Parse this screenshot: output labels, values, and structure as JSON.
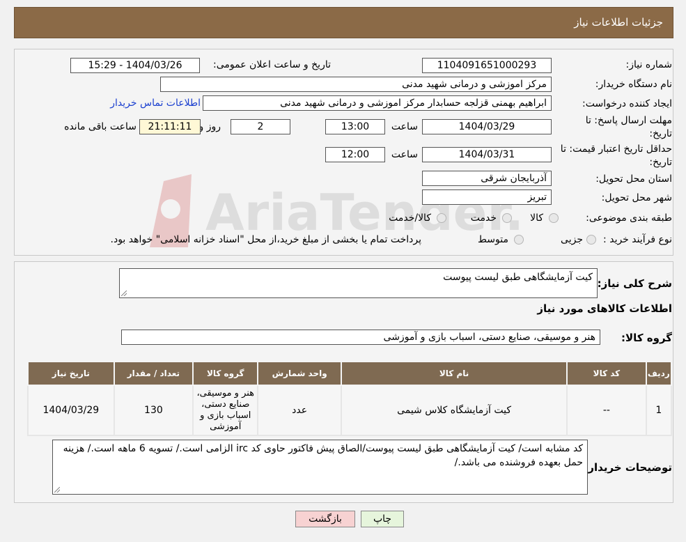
{
  "header": {
    "title": "جزئیات اطلاعات نیاز"
  },
  "form": {
    "need_number_label": "شماره نیاز:",
    "need_number": "1104091651000293",
    "announce_label": "تاریخ و ساعت اعلان عمومی:",
    "announce_value": "1404/03/26 - 15:29",
    "buyer_org_label": "نام دستگاه خریدار:",
    "buyer_org": "مرکز اموزشی و درمانی شهید مدنی",
    "requester_label": "ایجاد کننده درخواست:",
    "requester": "ابراهیم بهمنی قزلجه حسابدار مرکز اموزشی و درمانی شهید مدنی",
    "contact_link": "اطلاعات تماس خریدار",
    "deadline_label_1": "مهلت ارسال پاسخ: تا",
    "deadline_label_2": "تاریخ:",
    "deadline_date": "1404/03/29",
    "time_word": "ساعت",
    "deadline_time": "13:00",
    "days_value": "2",
    "days_word": "روز و",
    "remaining_time": "21:11:11",
    "remaining_word": "ساعت باقی مانده",
    "validity_label_1": "حداقل تاریخ اعتبار قیمت: تا",
    "validity_label_2": "تاریخ:",
    "validity_date": "1404/03/31",
    "validity_time": "12:00",
    "province_label": "استان محل تحویل:",
    "province": "آذربایجان شرقی",
    "city_label": "شهر محل تحویل:",
    "city": "تبریز",
    "category_label": "طبقه بندی موضوعی:",
    "category_options": [
      "کالا",
      "خدمت",
      "کالا/خدمت"
    ],
    "process_label": "نوع فرآیند خرید :",
    "process_options": [
      "جزیی",
      "متوسط"
    ],
    "process_note": "پرداخت تمام یا بخشی از مبلغ خرید،از محل \"اسناد خزانه اسلامی\" خواهد بود."
  },
  "summary": {
    "desc_label": "شرح کلی نیاز:",
    "desc_value": "کیت آزمایشگاهی طبق لیست پیوست",
    "goods_info_title": "اطلاعات کالاهای مورد نیاز",
    "group_label": "گروه کالا:",
    "group_value": "هنر و موسیقی، صنایع دستی، اسباب بازی و آموزشی"
  },
  "table": {
    "headers": [
      "ردیف",
      "کد کالا",
      "نام کالا",
      "واحد شمارش",
      "گروه کالا",
      "تعداد / مقدار",
      "تاریخ نیاز"
    ],
    "rows": [
      [
        "1",
        "--",
        "کیت آزمایشگاه کلاس شیمی",
        "عدد",
        "هنر و موسیقی، صنایع دستی، اسباب بازی و آموزشی",
        "130",
        "1404/03/29"
      ]
    ]
  },
  "notes": {
    "label": "توضیحات خریدار:",
    "value": "کد مشابه است/ کیت آزمایشگاهی طبق لیست پیوست/الصاق پیش فاکتور حاوی کد irc الزامی است./ تسویه 6 ماهه است./ هزینه حمل بعهده فروشنده می باشد./"
  },
  "buttons": {
    "print": "چاپ",
    "back": "بازگشت"
  },
  "colors": {
    "header_bg": "#8b6a47",
    "table_header_bg": "#7f6a52",
    "back_button_bg": "#f7d2d2",
    "print_button_bg": "#e6f5dc"
  }
}
